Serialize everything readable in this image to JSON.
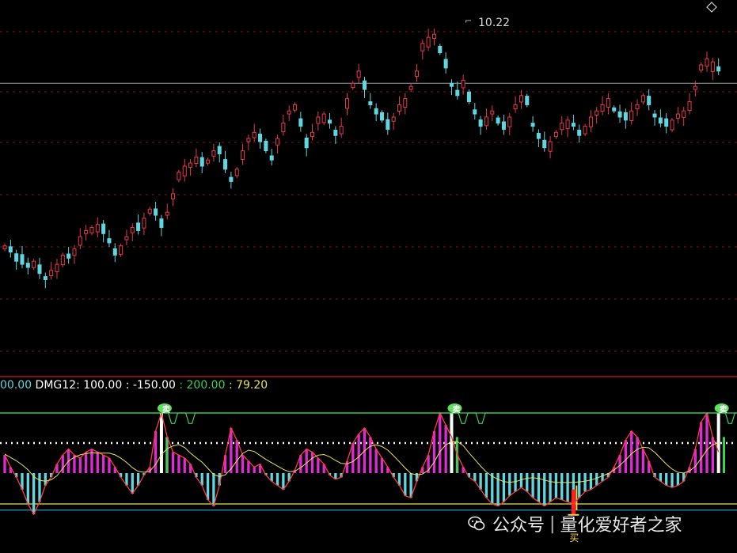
{
  "chart_data": [
    {
      "type": "candlestick",
      "title": "",
      "peak_label": "10.22",
      "ylim": [
        5.6,
        10.5
      ],
      "colors": {
        "up": "#e8384c",
        "down": "#5fd6e0",
        "grid": "#7a1818",
        "reference": "#a0a0a0"
      },
      "reference_line": 9.4,
      "closes": [
        6.75,
        6.65,
        6.5,
        6.45,
        6.4,
        6.5,
        6.3,
        6.2,
        6.35,
        6.45,
        6.6,
        6.55,
        6.7,
        6.9,
        7,
        7.05,
        7.1,
        6.95,
        6.8,
        6.6,
        6.75,
        6.9,
        7.05,
        7,
        7.2,
        7.35,
        7.25,
        7.05,
        7.3,
        7.6,
        7.95,
        8.05,
        8.1,
        8.2,
        8.05,
        8.15,
        8.3,
        8.25,
        8,
        7.8,
        8,
        8.3,
        8.5,
        8.6,
        8.45,
        8.3,
        8.15,
        8.5,
        8.75,
        8.95,
        9.05,
        8.7,
        8.35,
        8.6,
        8.85,
        8.9,
        8.75,
        8.55,
        8.7,
        9.15,
        9.4,
        9.6,
        9.3,
        9.05,
        8.9,
        8.8,
        8.65,
        8.85,
        9.05,
        9.15,
        9.35,
        9.6,
        10.05,
        10.15,
        10.2,
        9.9,
        9.65,
        9.35,
        9.2,
        9.45,
        9.1,
        8.9,
        8.7,
        8.85,
        8.95,
        8.75,
        8.65,
        8.85,
        9.05,
        9.2,
        9.05,
        8.7,
        8.5,
        8.35,
        8.45,
        8.6,
        8.75,
        8.8,
        8.7,
        8.55,
        8.7,
        8.85,
        8.95,
        9.05,
        9.15,
        8.95,
        8.85,
        8.8,
        8.95,
        9.05,
        9.2,
        9.05,
        8.85,
        8.75,
        8.7,
        8.8,
        8.9,
        8.95,
        9.1,
        9.35,
        9.7,
        9.8,
        9.75,
        9.6
      ],
      "down_days": [
        1,
        2,
        3,
        4,
        6,
        7,
        11,
        17,
        18,
        19,
        23,
        26,
        27,
        34,
        37,
        38,
        39,
        44,
        45,
        46,
        51,
        52,
        56,
        57,
        62,
        63,
        64,
        65,
        66,
        75,
        76,
        77,
        78,
        80,
        81,
        82,
        85,
        86,
        90,
        91,
        92,
        93,
        98,
        99,
        105,
        106,
        107,
        111,
        112,
        113,
        114,
        123
      ]
    },
    {
      "type": "bar",
      "indicator": "DMG12",
      "legend": [
        {
          "text": "00.00",
          "color": "#5fd6e0"
        },
        {
          "text": " DMG12: 100.00",
          "color": "#ffffff"
        },
        {
          "text": " : -150.00",
          "color": "#ffffff"
        },
        {
          "text": " : 200.00",
          "color": "#39d353"
        },
        {
          "text": " : 79.20",
          "color": "#e8e05a"
        }
      ],
      "ylim": [
        -300,
        200
      ],
      "levels": {
        "upper": 200,
        "dotted": 100,
        "zero": 0,
        "lower": -150,
        "bottom": -180
      },
      "colors": {
        "positive": "#e02ad8",
        "negative": "#5fd6e0",
        "signal": "#e8e05a",
        "curve": "#ff3c3c",
        "level": "#39d353",
        "highlight": "#ffffff",
        "buy": "#ffd24a"
      },
      "sell_signals": [
        27,
        77,
        123
      ],
      "sell_label": "卖",
      "buy_signal": 98,
      "buy_label": "买",
      "values": [
        60,
        20,
        -20,
        -80,
        -150,
        -200,
        -140,
        -60,
        -20,
        30,
        60,
        80,
        60,
        50,
        70,
        80,
        70,
        60,
        50,
        20,
        -20,
        -60,
        -100,
        -60,
        -10,
        20,
        140,
        200,
        120,
        70,
        60,
        50,
        30,
        -20,
        -60,
        -130,
        -160,
        -60,
        60,
        150,
        110,
        60,
        40,
        20,
        30,
        -10,
        -40,
        -60,
        -80,
        -40,
        10,
        60,
        80,
        70,
        50,
        30,
        -10,
        -30,
        -20,
        40,
        100,
        130,
        150,
        120,
        80,
        50,
        20,
        -20,
        -60,
        -110,
        -120,
        -40,
        20,
        60,
        140,
        200,
        160,
        120,
        60,
        20,
        -20,
        -40,
        -80,
        -120,
        -150,
        -160,
        -140,
        -110,
        -90,
        -70,
        -90,
        -120,
        -140,
        -160,
        -140,
        -120,
        -130,
        -140,
        -150,
        -120,
        -90,
        -80,
        -60,
        -40,
        -20,
        20,
        60,
        110,
        140,
        120,
        80,
        40,
        -20,
        -40,
        -60,
        -70,
        -60,
        -40,
        20,
        80,
        170,
        200,
        120,
        70
      ]
    }
  ],
  "watermark": {
    "prefix": "公众号",
    "name": "量化爱好者之家"
  }
}
